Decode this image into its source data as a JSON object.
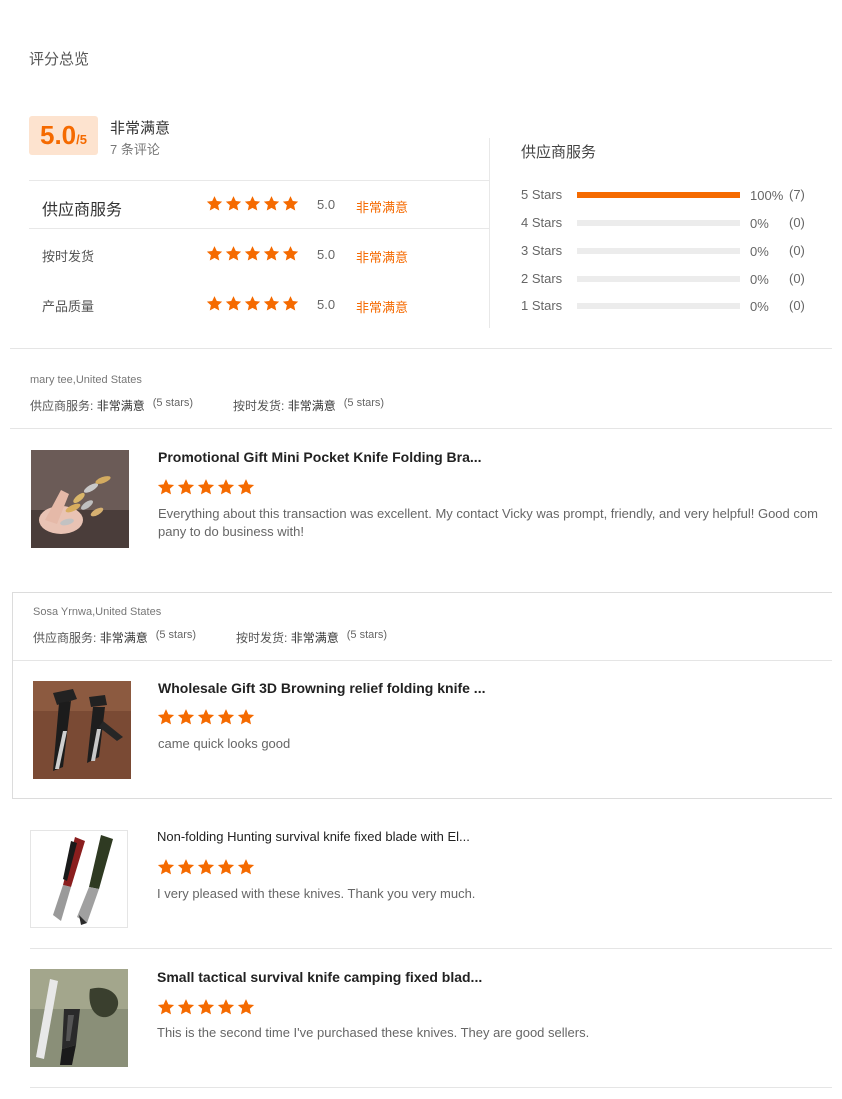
{
  "header": {
    "title": "评分总览"
  },
  "summary": {
    "score": "5.0",
    "score_suffix": "/5",
    "score_label": "非常满意",
    "review_count": "7 条评论",
    "rows": [
      {
        "label": "供应商服务",
        "score": "5.0",
        "text": "非常满意",
        "stars": 5
      },
      {
        "label": "按时发货",
        "score": "5.0",
        "text": "非常满意",
        "stars": 5
      },
      {
        "label": "产品质量",
        "score": "5.0",
        "text": "非常满意",
        "stars": 5
      }
    ]
  },
  "distribution": {
    "title": "供应商服务",
    "accent": "#f56a00",
    "rows": [
      {
        "label": "5 Stars",
        "fraction": 1.0,
        "pct": "100%",
        "count": "(7)"
      },
      {
        "label": "4 Stars",
        "fraction": 0.0,
        "pct": "0%",
        "count": "(0)"
      },
      {
        "label": "3 Stars",
        "fraction": 0.0,
        "pct": "0%",
        "count": "(0)"
      },
      {
        "label": "2 Stars",
        "fraction": 0.0,
        "pct": "0%",
        "count": "(0)"
      },
      {
        "label": "1 Stars",
        "fraction": 0.0,
        "pct": "0%",
        "count": "(0)"
      }
    ]
  },
  "reviews": [
    {
      "reviewer": "mary tee,United States",
      "tag1_label": "供应商服务:",
      "tag1_value": "非常满意",
      "tag1_stars": "(5 stars)",
      "tag2_label": "按时发货:",
      "tag2_value": "非常满意",
      "tag2_stars": "(5 stars)",
      "product_title": "Promotional Gift Mini Pocket Knife Folding Bra...",
      "stars": 5,
      "comment": "Everything about this transaction was excellent. My contact Vicky was prompt, friendly, and very helpful! Good company to do business with!"
    },
    {
      "reviewer": "Sosa Yrnwa,United States",
      "tag1_label": "供应商服务:",
      "tag1_value": "非常满意",
      "tag1_stars": "(5 stars)",
      "tag2_label": "按时发货:",
      "tag2_value": "非常满意",
      "tag2_stars": "(5 stars)",
      "product_title": "Wholesale Gift 3D Browning relief folding knife ...",
      "stars": 5,
      "comment": "came quick looks good"
    },
    {
      "product_title": "Non-folding Hunting survival knife fixed blade with El...",
      "stars": 5,
      "comment": "I very pleased with these knives. Thank you very much."
    },
    {
      "product_title": "Small tactical survival knife camping fixed blad...",
      "stars": 5,
      "comment": "This is the second time I've purchased these knives. They are good sellers."
    }
  ]
}
